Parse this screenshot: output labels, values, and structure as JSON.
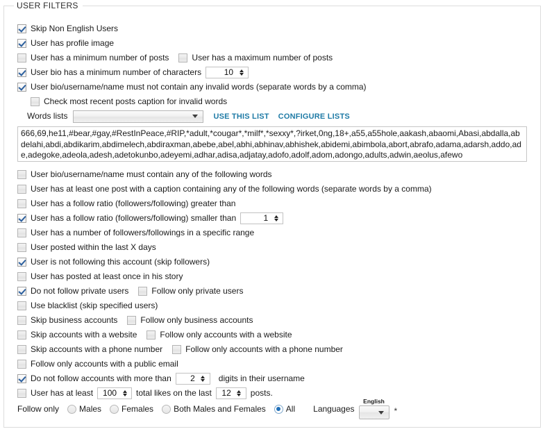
{
  "groupbox": {
    "title": "USER FILTERS"
  },
  "filters": [
    {
      "id": "skip-non-english-users",
      "checked": true,
      "label": "Skip Non English Users"
    },
    {
      "id": "user-has-profile-image",
      "checked": true,
      "label": "User has profile image"
    },
    {
      "id": "user-min-posts",
      "checked": false,
      "label": "User has a minimum number of posts"
    },
    {
      "id": "user-max-posts",
      "checked": false,
      "label": "User has a maximum number of posts"
    },
    {
      "id": "user-bio-min-chars",
      "checked": true,
      "label": "User bio has a minimum number of characters",
      "value": "10"
    },
    {
      "id": "user-bio-invalid-words",
      "checked": true,
      "label": "User bio/username/name must not contain any invalid words (separate words by a comma)"
    },
    {
      "id": "check-recent-posts-caption",
      "checked": false,
      "label": "Check most recent posts caption for invalid words"
    },
    {
      "id": "user-bio-must-contain",
      "checked": false,
      "label": "User bio/username/name must contain any of the following words"
    },
    {
      "id": "user-post-caption-contains",
      "checked": false,
      "label": "User has at least one post with a caption containing any of the following words (separate words by a comma)"
    },
    {
      "id": "follow-ratio-greater",
      "checked": false,
      "label": "User has a follow ratio (followers/following) greater than"
    },
    {
      "id": "follow-ratio-smaller",
      "checked": true,
      "label": "User has a follow ratio (followers/following) smaller than",
      "value": "1"
    },
    {
      "id": "followers-in-range",
      "checked": false,
      "label": "User has a number of followers/followings in a specific range"
    },
    {
      "id": "user-posted-last-x-days",
      "checked": false,
      "label": "User posted within the last X days"
    },
    {
      "id": "user-not-following-account",
      "checked": true,
      "label": "User is not following this account (skip followers)"
    },
    {
      "id": "user-posted-story",
      "checked": false,
      "label": "User has posted at least once in his story"
    },
    {
      "id": "do-not-follow-private",
      "checked": true,
      "label": "Do not follow private users"
    },
    {
      "id": "follow-only-private",
      "checked": false,
      "label": "Follow only private users"
    },
    {
      "id": "use-blacklist",
      "checked": false,
      "label": "Use blacklist (skip specified users)"
    },
    {
      "id": "skip-business-accounts",
      "checked": false,
      "label": "Skip business accounts"
    },
    {
      "id": "follow-only-business-accounts",
      "checked": false,
      "label": "Follow only business accounts"
    },
    {
      "id": "skip-accounts-website",
      "checked": false,
      "label": "Skip accounts with a website"
    },
    {
      "id": "follow-only-accounts-website",
      "checked": false,
      "label": "Follow only accounts with a website"
    },
    {
      "id": "skip-accounts-phone",
      "checked": false,
      "label": "Skip accounts with a phone number"
    },
    {
      "id": "follow-only-accounts-phone",
      "checked": false,
      "label": "Follow only accounts with a phone number"
    },
    {
      "id": "follow-only-public-email",
      "checked": false,
      "label": "Follow only accounts with a public email"
    },
    {
      "id": "do-not-follow-digits",
      "checked": true,
      "label": "Do not follow accounts with more than",
      "label_suffix": "digits in their username",
      "value": "2"
    },
    {
      "id": "user-total-likes",
      "checked": false,
      "label": "User has at least",
      "label_mid": "total likes on the last",
      "label_suffix": "posts.",
      "value_likes": "100",
      "value_posts": "12"
    }
  ],
  "words_list": {
    "label": "Words lists",
    "selected": "",
    "use_this_list": "USE THIS LIST",
    "configure_lists": "CONFIGURE LISTS",
    "content": "666,69,he11,#bear,#gay,#RestInPeace,#RIP,*adult,*cougar*,*milf*,*sexxy*,?irket,0ng,18+,a55,a55hole,aakash,abaomi,Abasi,abdalla,abdelahi,abdi,abdikarim,abdimelech,abdiraxman,abebe,abel,abhi,abhinav,abhishek,abidemi,abimbola,abort,abrafo,adama,adarsh,addo,ade,adegoke,adeola,adesh,adetokunbo,adeyemi,adhar,adisa,adjatay,adofo,adolf,adom,adongo,adults,adwin,aeolus,afewo"
  },
  "follow_only": {
    "label": "Follow only",
    "options": [
      {
        "id": "males",
        "label": "Males",
        "selected": false
      },
      {
        "id": "females",
        "label": "Females",
        "selected": false
      },
      {
        "id": "both",
        "label": "Both Males and Females",
        "selected": false
      },
      {
        "id": "all",
        "label": "All",
        "selected": true
      }
    ]
  },
  "languages": {
    "label": "Languages",
    "caption": "English",
    "selected": "",
    "asterisk": "*"
  }
}
